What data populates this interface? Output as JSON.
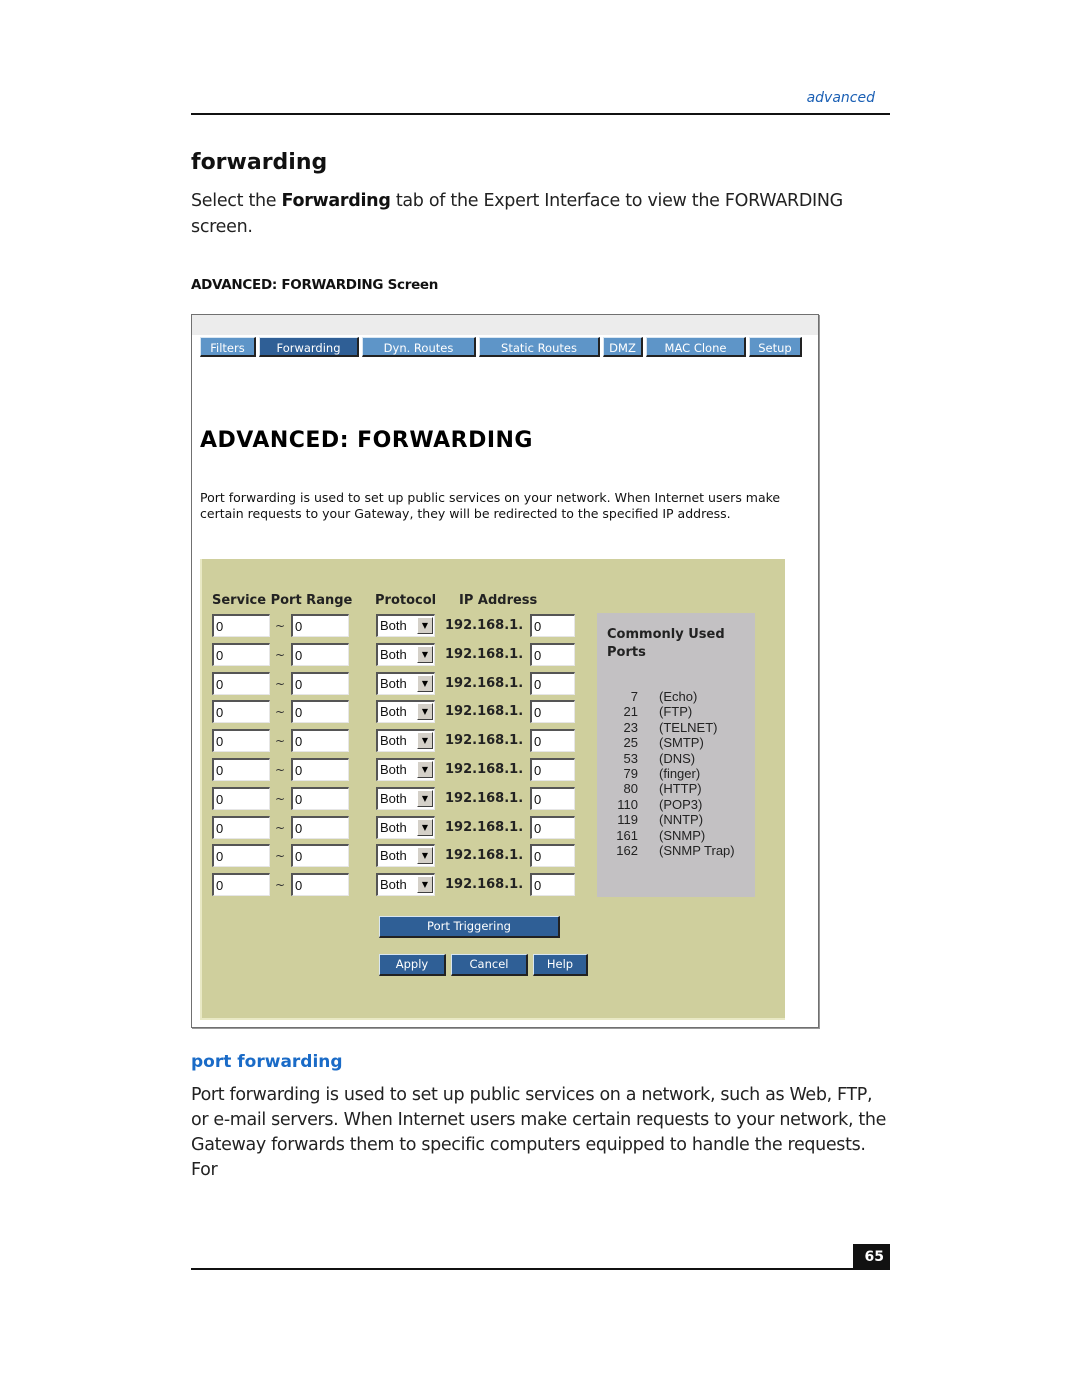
{
  "header": {
    "section_tag": "advanced"
  },
  "heading": "forwarding",
  "intro": {
    "before": "Select the ",
    "bold": "Forwarding",
    "after": " tab of the Expert Interface to view the FORWARDING screen."
  },
  "figure_caption": "ADVANCED: FORWARDING Screen",
  "screen": {
    "tabs": [
      {
        "label": "Filters",
        "active": false
      },
      {
        "label": "Forwarding",
        "active": true
      },
      {
        "label": "Dyn. Routes",
        "active": false
      },
      {
        "label": "Static Routes",
        "active": false
      },
      {
        "label": "DMZ",
        "active": false
      },
      {
        "label": "MAC Clone",
        "active": false
      },
      {
        "label": "Setup",
        "active": false
      }
    ],
    "title": "ADVANCED: FORWARDING",
    "description": "Port forwarding is used to set up public services on your network. When Internet users make certain requests to your Gateway, they will be redirected to the specified IP address.",
    "columns": {
      "service_port_range": "Service Port Range",
      "protocol": "Protocol",
      "ip_address": "IP Address"
    },
    "range_separator": "~",
    "ip_prefix": "192.168.1.",
    "rows": [
      {
        "port_start": "0",
        "port_end": "0",
        "protocol": "Both",
        "ip_last": "0"
      },
      {
        "port_start": "0",
        "port_end": "0",
        "protocol": "Both",
        "ip_last": "0"
      },
      {
        "port_start": "0",
        "port_end": "0",
        "protocol": "Both",
        "ip_last": "0"
      },
      {
        "port_start": "0",
        "port_end": "0",
        "protocol": "Both",
        "ip_last": "0"
      },
      {
        "port_start": "0",
        "port_end": "0",
        "protocol": "Both",
        "ip_last": "0"
      },
      {
        "port_start": "0",
        "port_end": "0",
        "protocol": "Both",
        "ip_last": "0"
      },
      {
        "port_start": "0",
        "port_end": "0",
        "protocol": "Both",
        "ip_last": "0"
      },
      {
        "port_start": "0",
        "port_end": "0",
        "protocol": "Both",
        "ip_last": "0"
      },
      {
        "port_start": "0",
        "port_end": "0",
        "protocol": "Both",
        "ip_last": "0"
      },
      {
        "port_start": "0",
        "port_end": "0",
        "protocol": "Both",
        "ip_last": "0"
      }
    ],
    "dropdown_icon": "triangle-down",
    "common_ports": {
      "title": "Commonly Used Ports",
      "items": [
        {
          "port": "7",
          "name": "(Echo)"
        },
        {
          "port": "21",
          "name": "(FTP)"
        },
        {
          "port": "23",
          "name": "(TELNET)"
        },
        {
          "port": "25",
          "name": "(SMTP)"
        },
        {
          "port": "53",
          "name": "(DNS)"
        },
        {
          "port": "79",
          "name": "(finger)"
        },
        {
          "port": "80",
          "name": "(HTTP)"
        },
        {
          "port": "110",
          "name": "(POP3)"
        },
        {
          "port": "119",
          "name": "(NNTP)"
        },
        {
          "port": "161",
          "name": "(SNMP)"
        },
        {
          "port": "162",
          "name": "(SNMP Trap)"
        }
      ]
    },
    "buttons": {
      "port_triggering": "Port Triggering",
      "apply": "Apply",
      "cancel": "Cancel",
      "help": "Help"
    }
  },
  "subsection": {
    "heading": "port forwarding",
    "body": "Port forwarding is used to set up public services on a network, such as Web, FTP, or e-mail servers. When Internet users make certain requests to your network, the Gateway forwards them to specific computers equipped to handle the requests. For"
  },
  "footer": {
    "page_number": "65"
  },
  "colors": {
    "tab_blue": "#5e95c8",
    "tab_active": "#2f5f96",
    "panel_bg": "#cfcf9d",
    "ports_box_bg": "#c3c1c3",
    "accent_blue": "#1a6bc7"
  }
}
